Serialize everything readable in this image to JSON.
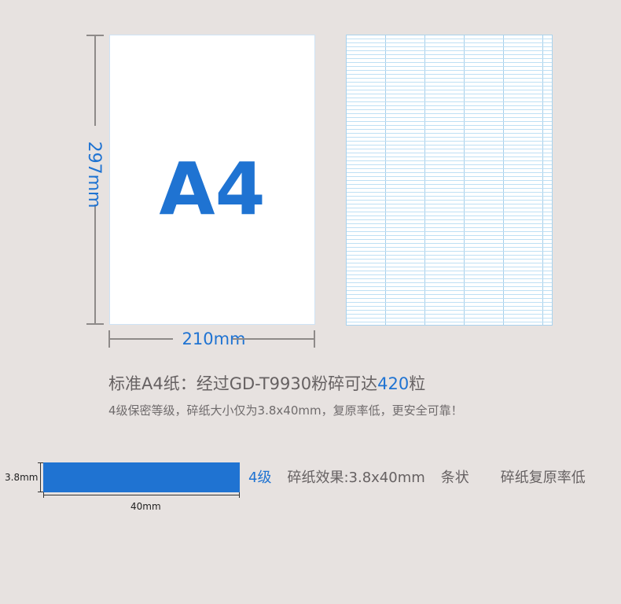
{
  "a4_paper": {
    "label": "A4"
  },
  "dimensions": {
    "height": "297mm",
    "width": "210mm"
  },
  "headline": {
    "prefix": "标准A4纸：经过GD-T9930粉碎可达",
    "count": "420",
    "suffix": "粒"
  },
  "subline": "4级保密等级，碎纸大小仅为3.8x40mm，复原率低，更安全可靠！",
  "particle": {
    "height_label": "3.8mm",
    "width_label": "40mm"
  },
  "effect": {
    "level": "4级",
    "size": "碎纸效果:3.8x40mm",
    "shape": "条状",
    "recovery": "碎纸复原率低"
  },
  "colors": {
    "accent": "#1f73d2",
    "background": "#e7e2e0",
    "grid": "#a6cfea"
  }
}
